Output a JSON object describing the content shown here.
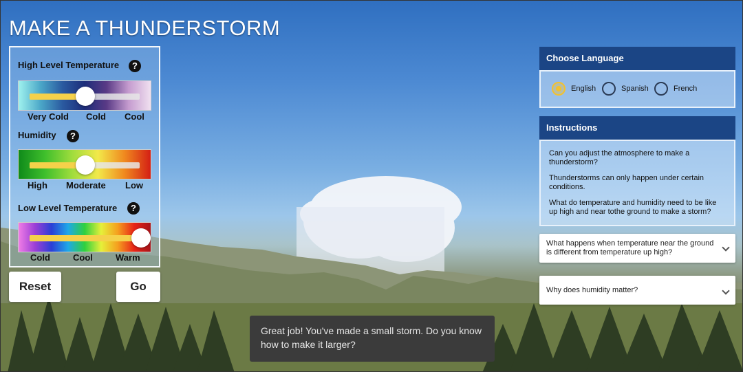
{
  "title": "MAKE A THUNDERSTORM",
  "controls": {
    "high_temp": {
      "label": "High Level Temperature",
      "help": "?",
      "ticks": [
        "Very Cold",
        "Cold",
        "Cool"
      ],
      "value_fraction": 0.5,
      "gradient": [
        "#9ff2ee",
        "#4ba7c8",
        "#2a5aa0",
        "#1d2d7a",
        "#5a3a86",
        "#c59ccf",
        "#f0e0f0"
      ]
    },
    "humidity": {
      "label": "Humidity",
      "help": "?",
      "ticks": [
        "High",
        "Moderate",
        "Low"
      ],
      "value_fraction": 0.5,
      "gradient": [
        "#0f8a1a",
        "#3fbf2c",
        "#9ddc3c",
        "#f2e94a",
        "#f08a1f",
        "#d41f14"
      ]
    },
    "low_temp": {
      "label": "Low Level Temperature",
      "help": "?",
      "ticks": [
        "Cold",
        "Cool",
        "Warm"
      ],
      "value_fraction": 1.0,
      "gradient": [
        "#f07ce6",
        "#9b3fd6",
        "#2a3fd6",
        "#1fa8e8",
        "#2fd03f",
        "#e6f03a",
        "#f5a01f",
        "#e82417",
        "#a8141a"
      ]
    }
  },
  "buttons": {
    "reset": "Reset",
    "go": "Go"
  },
  "language": {
    "header": "Choose Language",
    "options": [
      "English",
      "Spanish",
      "French"
    ],
    "selected": "English"
  },
  "instructions": {
    "header": "Instructions",
    "paragraphs": [
      "Can you adjust the atmosphere to make a thunderstorm?",
      "Thunderstorms can only happen under certain conditions.",
      "What do temperature and humidity need to be like up high and near tothe ground to make a storm?"
    ]
  },
  "accordions": [
    "What happens when temperature near the ground is different from temperature up high?",
    "Why does humidity matter?"
  ],
  "toast": "Great job! You've made a small storm. Do you know how to make it larger?",
  "colors": {
    "panel_header": "#1b4585",
    "slider_fill": "#f5d14a",
    "radio_selected": "#f3c12e"
  }
}
